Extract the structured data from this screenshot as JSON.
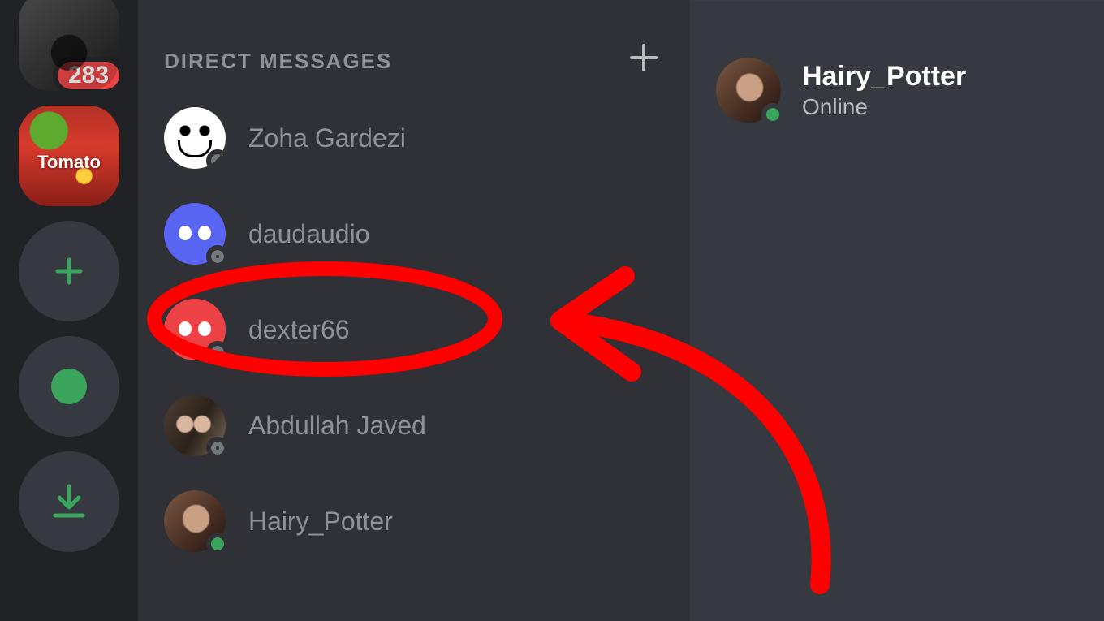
{
  "server_rail": {
    "server1_badge": "283",
    "server2_label": "Tomato"
  },
  "dm_panel": {
    "header": "DIRECT MESSAGES",
    "items": [
      {
        "name": "Zoha Gardezi",
        "status": "offline",
        "avatar": "meme"
      },
      {
        "name": "daudaudio",
        "status": "offline",
        "avatar": "discord-blurple"
      },
      {
        "name": "dexter66",
        "status": "offline",
        "avatar": "discord-red"
      },
      {
        "name": "Abdullah Javed",
        "status": "offline",
        "avatar": "photo1"
      },
      {
        "name": "Hairy_Potter",
        "status": "online",
        "avatar": "photo2"
      }
    ]
  },
  "profile": {
    "name": "Hairy_Potter",
    "status_label": "Online",
    "status": "online",
    "avatar": "photo2"
  },
  "annotation": {
    "highlight_index": 2,
    "color": "#ff0000"
  }
}
